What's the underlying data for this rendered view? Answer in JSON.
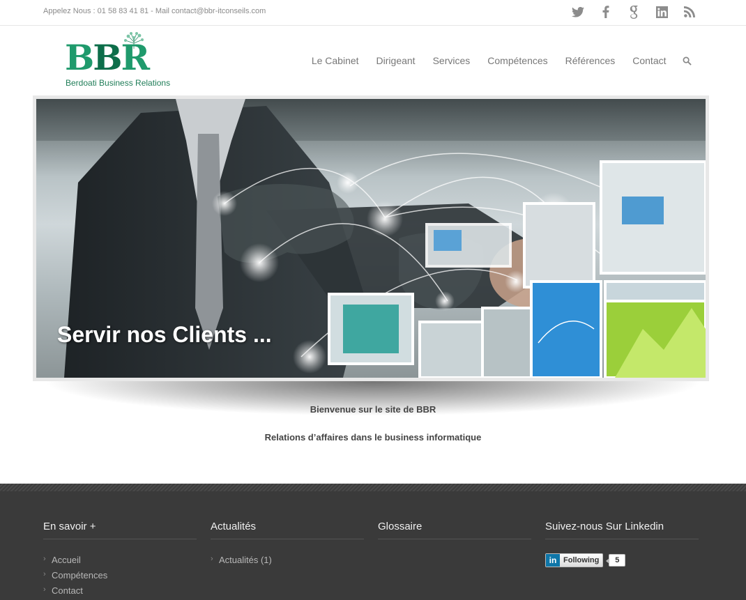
{
  "topbar": {
    "contact_line": "Appelez Nous : 01 58 83 41 81 - Mail contact@bbr-itconseils.com",
    "socials": [
      "twitter-icon",
      "facebook-icon",
      "google-plus-icon",
      "linkedin-icon",
      "rss-icon"
    ]
  },
  "logo": {
    "letters": [
      "B",
      "B",
      "R"
    ],
    "subtitle": "Berdoati Business Relations"
  },
  "nav": {
    "items": [
      "Le Cabinet",
      "Dirigeant",
      "Services",
      "Compétences",
      "Références",
      "Contact"
    ]
  },
  "slider": {
    "caption": "Servir nos Clients ..."
  },
  "welcome": {
    "line1": "Bienvenue sur le site de BBR",
    "line2": "Relations d’affaires dans le business informatique"
  },
  "footer": {
    "col1": {
      "title": "En savoir +",
      "links": [
        "Accueil",
        "Compétences",
        "Contact"
      ]
    },
    "col2": {
      "title": "Actualités",
      "links": [
        "Actualités (1)"
      ]
    },
    "col3": {
      "title": "Glossaire"
    },
    "col4": {
      "title": "Suivez-nous Sur Linkedin",
      "follow_label": "Following",
      "follow_count": "5"
    }
  },
  "colors": {
    "brand_green": "#1f9a6c",
    "footer_bg": "#3a3a3a",
    "linkedin_blue": "#0e76a8"
  }
}
